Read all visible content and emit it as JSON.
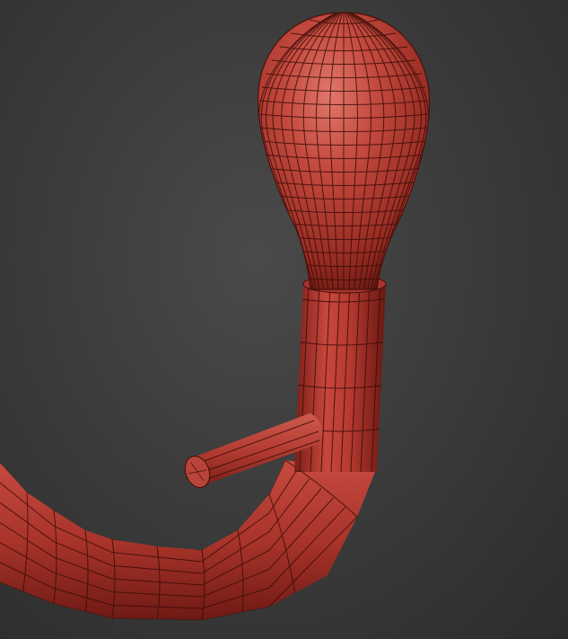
{
  "scene": {
    "subject": "bulb-handle-model",
    "colors": {
      "background_center": "#4a4a4a",
      "background_edge": "#2c2c2c",
      "surface_light": "#d45a4e",
      "surface_base": "#b8372d",
      "surface_dark": "#6e1a14",
      "wireframe": "#3a0c08"
    }
  }
}
